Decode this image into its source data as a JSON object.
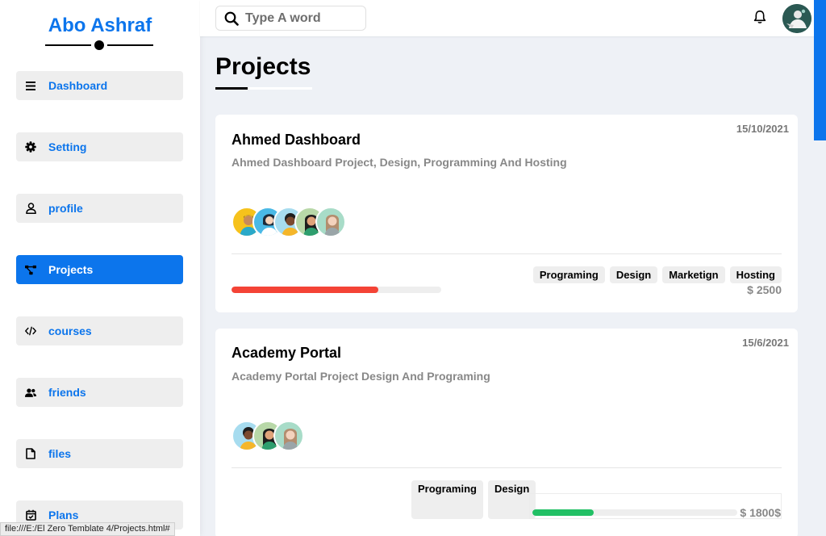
{
  "brand": {
    "name": "Abo Ashraf"
  },
  "sidebar": {
    "items": [
      {
        "label": "Dashboard",
        "icon": "menu-icon",
        "active": false
      },
      {
        "label": "Setting",
        "icon": "gear-icon",
        "active": false
      },
      {
        "label": "profile",
        "icon": "user-icon",
        "active": false
      },
      {
        "label": "Projects",
        "icon": "project-diagram-icon",
        "active": true
      },
      {
        "label": "courses",
        "icon": "code-icon",
        "active": false
      },
      {
        "label": "friends",
        "icon": "users-icon",
        "active": false
      },
      {
        "label": "files",
        "icon": "file-icon",
        "active": false
      },
      {
        "label": "Plans",
        "icon": "calendar-check-icon",
        "active": false
      }
    ]
  },
  "header": {
    "search": {
      "placeholder": "Type A word",
      "value": ""
    },
    "icons": [
      "search-icon",
      "bell-icon",
      "avatar"
    ]
  },
  "main": {
    "title": "Projects",
    "projects": [
      {
        "title": "Ahmed Dashboard",
        "date": "15/10/2021",
        "description": "Ahmed Dashboard Project, Design, Programming And Hosting",
        "team_count": 5,
        "tags": [
          "Programing",
          "Design",
          "Marketign",
          "Hosting"
        ],
        "price": "$ 2500",
        "progress": 0.7,
        "progress_color": "#f44336"
      },
      {
        "title": "Academy Portal",
        "date": "15/6/2021",
        "description": "Academy Portal Project Design And Programing",
        "team_count": 3,
        "tags": [
          "Programing",
          "Design"
        ],
        "price": "$ 1800$",
        "progress": 0.3,
        "progress_color": "#22c065"
      }
    ]
  },
  "colors": {
    "accent": "#0c75ec",
    "background": "#eef1f6"
  },
  "statusbar": {
    "text": "file:///E:/El Zero Temblate 4/Projects.html#"
  }
}
